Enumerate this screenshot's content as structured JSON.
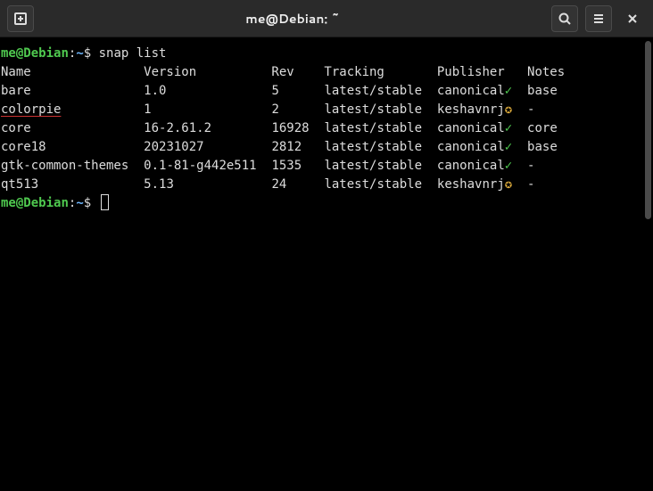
{
  "titlebar": {
    "title": "me@Debian: ~"
  },
  "prompt": {
    "user": "me",
    "at": "@",
    "host": "Debian",
    "colon": ":",
    "path": "~",
    "dollar": "$ ",
    "command": "snap list"
  },
  "table": {
    "headers": {
      "name": "Name",
      "version": "Version",
      "rev": "Rev",
      "tracking": "Tracking",
      "publisher": "Publisher",
      "notes": "Notes"
    },
    "rows": [
      {
        "name": "bare",
        "version": "1.0",
        "rev": "5",
        "tracking": "latest/stable",
        "publisher": "canonical",
        "badge": "check",
        "notes": "base"
      },
      {
        "name": "colorpie",
        "version": "1",
        "rev": "2",
        "tracking": "latest/stable",
        "publisher": "keshavnrj",
        "badge": "star",
        "notes": "-",
        "link": true
      },
      {
        "name": "core",
        "version": "16-2.61.2",
        "rev": "16928",
        "tracking": "latest/stable",
        "publisher": "canonical",
        "badge": "check",
        "notes": "core"
      },
      {
        "name": "core18",
        "version": "20231027",
        "rev": "2812",
        "tracking": "latest/stable",
        "publisher": "canonical",
        "badge": "check",
        "notes": "base"
      },
      {
        "name": "gtk-common-themes",
        "version": "0.1-81-g442e511",
        "rev": "1535",
        "tracking": "latest/stable",
        "publisher": "canonical",
        "badge": "check",
        "notes": "-"
      },
      {
        "name": "qt513",
        "version": "5.13",
        "rev": "24",
        "tracking": "latest/stable",
        "publisher": "keshavnrj",
        "badge": "star",
        "notes": "-"
      }
    ]
  },
  "cols": {
    "name": 19,
    "version": 17,
    "rev": 7,
    "tracking": 15,
    "publisher": 12
  },
  "badges": {
    "check": "✓",
    "star": "✪"
  }
}
